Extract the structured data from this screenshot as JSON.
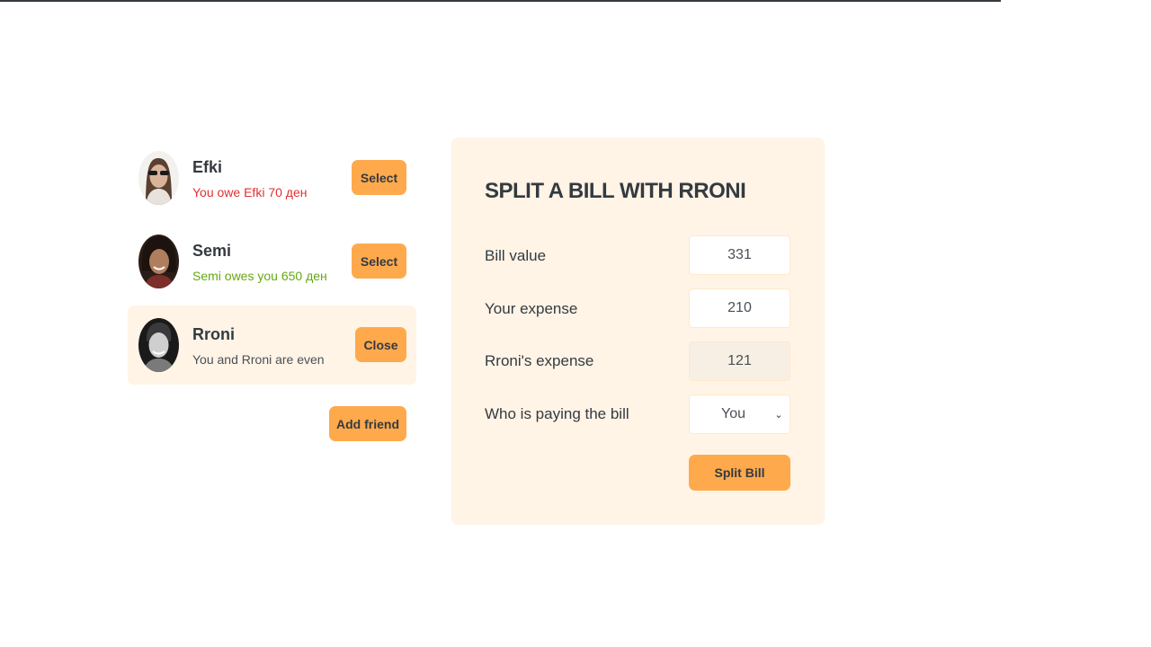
{
  "friends": [
    {
      "name": "Efki",
      "balance": "You owe Efki 70 ден",
      "status": "owe",
      "button": "Select"
    },
    {
      "name": "Semi",
      "balance": "Semi owes you 650 ден",
      "status": "owed",
      "button": "Select"
    },
    {
      "name": "Rroni",
      "balance": "You and Rroni are even",
      "status": "even",
      "button": "Close"
    }
  ],
  "add_friend_label": "Add friend",
  "split": {
    "title": "Split a bill with Rroni",
    "bill_value_label": "Bill value",
    "bill_value": "331",
    "your_expense_label": "Your expense",
    "your_expense": "210",
    "friend_expense_label": "Rroni's expense",
    "friend_expense": "121",
    "payer_label": "Who is paying the bill",
    "payer_selected": "You",
    "submit_label": "Split Bill"
  },
  "colors": {
    "accent": "#ffa94d",
    "panel_bg": "#fff4e6",
    "owe_red": "#e03131",
    "owed_green": "#66a80f"
  }
}
